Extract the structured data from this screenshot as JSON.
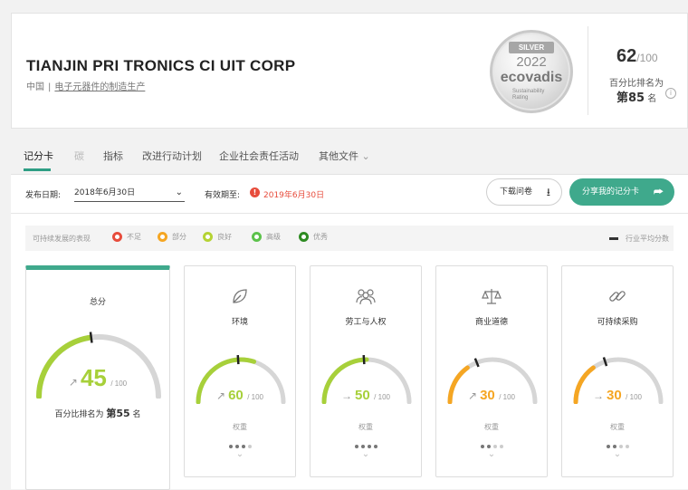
{
  "header": {
    "company_name": "TIANJIN PRI  TRONICS CI   UIT CORP",
    "country": "中国",
    "sector": "电子元器件的制造生产",
    "medal": {
      "tag": "SILVER",
      "year": "2022",
      "brand": "ecovadis",
      "rating_line1": "Sustainability",
      "rating_line2": "Rating"
    },
    "score": "62",
    "score_max": "/100",
    "percentile_label": "百分比排名为",
    "percentile_rank": "第85",
    "percentile_suffix": "名",
    "info_icon": "i"
  },
  "tabs": [
    {
      "label": "记分卡",
      "active": true
    },
    {
      "label": "碳"
    },
    {
      "label": "指标"
    },
    {
      "label": "改进行动计划"
    },
    {
      "label": "企业社会责任活动"
    },
    {
      "label": "其他文件"
    }
  ],
  "toolbar": {
    "publish_label": "发布日期:",
    "publish_date": "2018年6月30日",
    "valid_label": "有效期至:",
    "valid_date": "2019年6月30日",
    "download_label": "下载问卷",
    "share_label": "分享我的记分卡"
  },
  "legend": {
    "label": "可持续发展的表现",
    "items": [
      {
        "label": "不足",
        "color": "#e74c3c"
      },
      {
        "label": "部分",
        "color": "#f5a623"
      },
      {
        "label": "良好",
        "color": "#b5d334"
      },
      {
        "label": "高级",
        "color": "#5cc24b"
      },
      {
        "label": "优秀",
        "color": "#2e8b22"
      }
    ],
    "average_label": "行业平均分数"
  },
  "overall": {
    "title": "总分",
    "score": "45",
    "max": "/ 100",
    "score_value": 45,
    "industry_avg": 46,
    "color": "#a7d03a",
    "trend": "↗",
    "rank_label": "百分比排名为",
    "rank": "第55",
    "rank_suffix": "名"
  },
  "themes": [
    {
      "title": "环境",
      "icon": "leaf-icon",
      "score": "60",
      "score_value": 60,
      "industry_avg": 48,
      "max": "/ 100",
      "color": "#a7d03a",
      "trend": "↗",
      "weight_label": "权重",
      "weight": 3
    },
    {
      "title": "劳工与人权",
      "icon": "people-icon",
      "score": "50",
      "score_value": 50,
      "industry_avg": 48,
      "max": "/ 100",
      "color": "#a7d03a",
      "trend": "→",
      "weight_label": "权重",
      "weight": 4
    },
    {
      "title": "商业道德",
      "icon": "scales-icon",
      "score": "30",
      "score_value": 30,
      "industry_avg": 38,
      "max": "/ 100",
      "color": "#f5a623",
      "trend": "↗",
      "weight_label": "权重",
      "weight": 2
    },
    {
      "title": "可持续采购",
      "icon": "chain-link-icon",
      "score": "30",
      "score_value": 30,
      "industry_avg": 40,
      "max": "/ 100",
      "color": "#f5a623",
      "trend": "→",
      "weight_label": "权重",
      "weight": 2
    }
  ]
}
